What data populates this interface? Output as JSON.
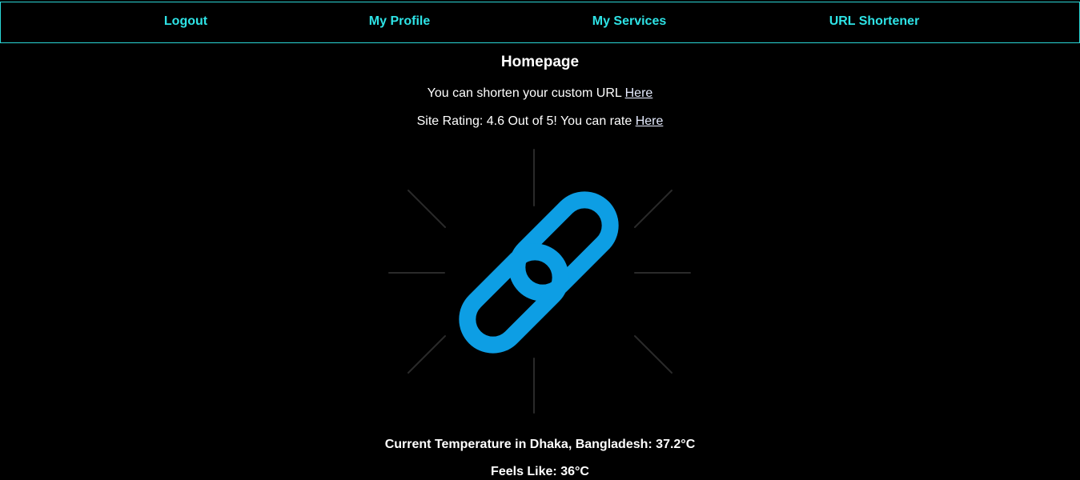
{
  "nav": {
    "logout": "Logout",
    "profile": "My Profile",
    "services": "My Services",
    "shortener": "URL Shortener"
  },
  "main": {
    "title": "Homepage",
    "shorten_text": "You can shorten your custom URL ",
    "shorten_link": "Here",
    "rating_text": "Site Rating: 4.6 Out of 5! You can rate ",
    "rating_link": "Here",
    "logo_icon": "chain-link-icon"
  },
  "weather": {
    "temperature_text": "Current Temperature in Dhaka, Bangladesh: 37.2°C",
    "feels_like_text": "Feels Like: 36°C"
  },
  "colors": {
    "background": "#000000",
    "nav_text": "#2ee3e6",
    "nav_border": "#2ad6d6",
    "link_icon": "#0d9ee4",
    "rays": "#2a2a2a"
  }
}
